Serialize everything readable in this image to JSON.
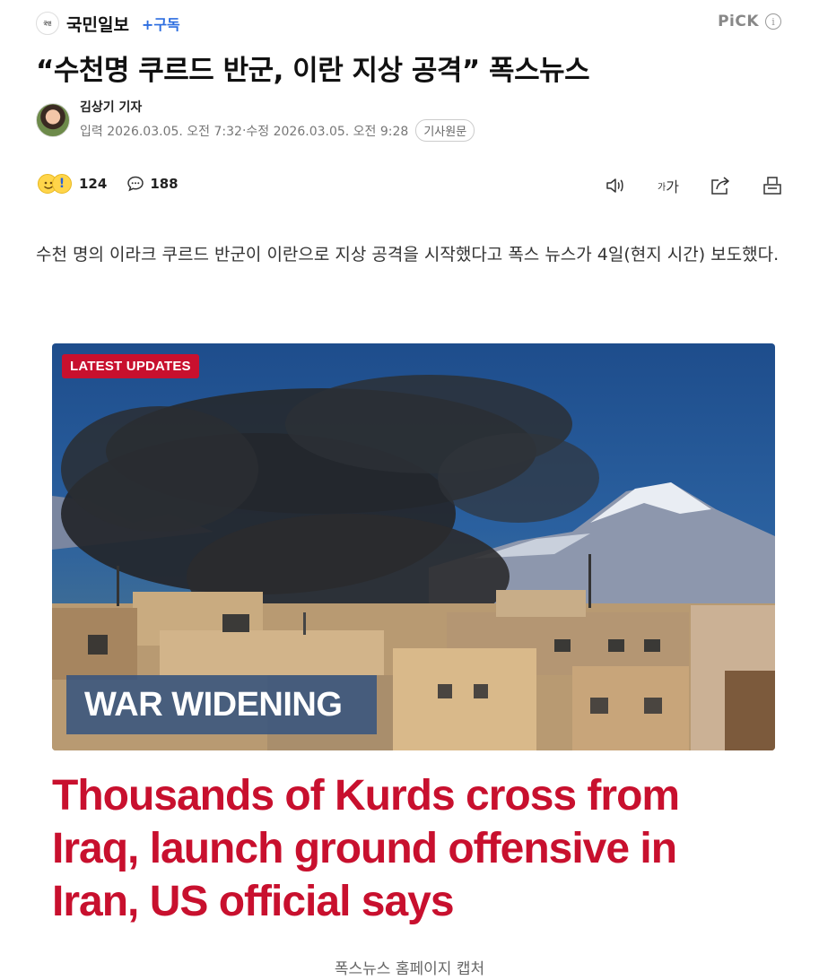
{
  "header": {
    "press_name": "국민일보",
    "subscribe_label": "+구독",
    "pick_label": "PiCK",
    "info_icon": "info-icon"
  },
  "article": {
    "headline": "“수천명 쿠르드 반군, 이란 지상 공격” 폭스뉴스",
    "reporter": "김상기 기자",
    "published_label": "입력",
    "published": "2026.03.05. 오전 7:32",
    "modified_label": "수정",
    "modified": "2026.03.05. 오전 9:28",
    "original_button": "기사원문",
    "lead": "수천 명의 이라크 쿠르드 반군이 이란으로 지상 공격을 시작했다고 폭스 뉴스가 4일(현지 시간) 보도했다."
  },
  "reactions": {
    "reaction_count": "124",
    "comment_count": "188"
  },
  "tools": {
    "font_size_label_small": "가",
    "font_size_label_large": "가"
  },
  "image": {
    "badge": "LATEST UPDATES",
    "banner": "WAR WIDENING",
    "headline": "Thousands of Kurds cross from Iraq, launch ground offensive in Iran, US official says",
    "caption": "폭스뉴스 홈페이지 캡처"
  },
  "colors": {
    "accent_blue": "#2d6ee0",
    "fox_red": "#c8102e",
    "banner_blue": "#305080"
  }
}
